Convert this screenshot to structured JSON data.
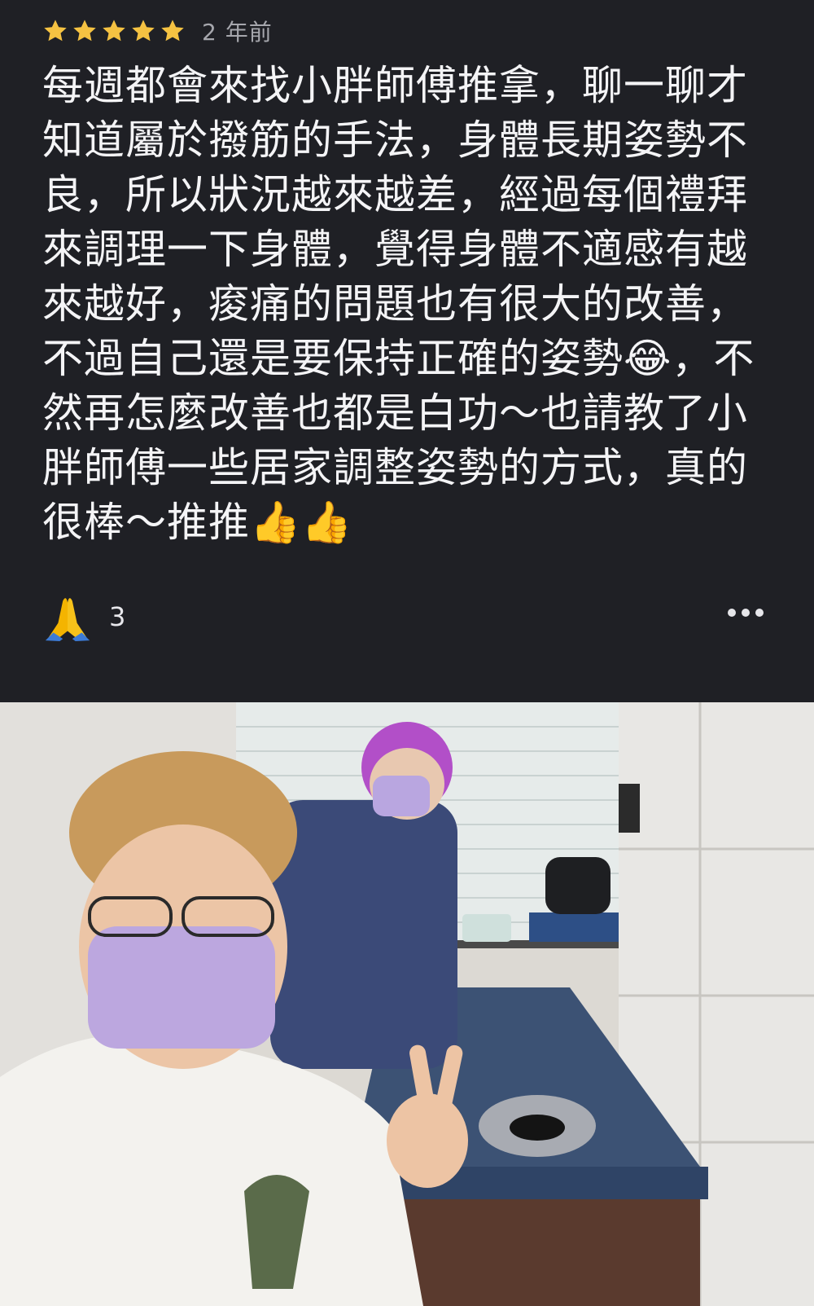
{
  "rating": {
    "stars": 5,
    "star_color": "#f5c242",
    "icons": [
      "star-icon",
      "star-icon",
      "star-icon",
      "star-icon",
      "star-icon"
    ]
  },
  "time_ago": "2 年前",
  "review_text": "每週都會來找小胖師傅推拿，聊一聊才知道屬於撥筋的手法，身體長期姿勢不良，所以狀況越來越差，經過每個禮拜來調理一下身體，覺得身體不適感有越來越好，痠痛的問題也有很大的改善，不過自己還是要保持正確的姿勢😂，不然再怎麼改善也都是白功～也請教了小胖師傅一些居家調整姿勢的方式，真的很棒～推推👍👍",
  "reaction": {
    "icon": "folded-hands-icon",
    "count": "3"
  },
  "more_icon": "more-horizontal-icon",
  "photo": {
    "icon": "review-photo"
  },
  "colors": {
    "background": "#1f2025",
    "text": "#f4f4f6",
    "muted": "#a6a7ad"
  }
}
